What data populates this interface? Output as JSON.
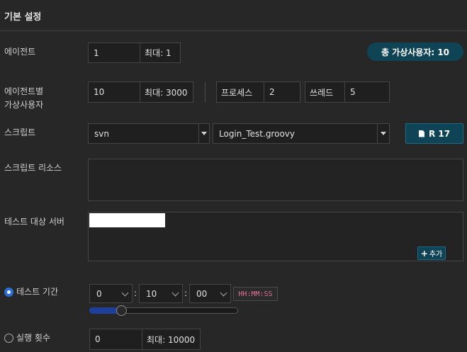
{
  "section_title": "기본 설정",
  "agent": {
    "label": "에이전트",
    "value": "1",
    "max_label": "최대: 1",
    "total_vusers": "총 가상사용자: 10"
  },
  "vusers_per_agent": {
    "label_line1": "에이전트별",
    "label_line2": "가상사용자",
    "value": "10",
    "max_label": "최대: 3000",
    "process_label": "프로세스",
    "process_value": "2",
    "thread_label": "쓰레드",
    "thread_value": "5"
  },
  "script": {
    "label": "스크립트",
    "repo": "svn",
    "file": "Login_Test.groovy",
    "revision_button": "R 17"
  },
  "script_resources": {
    "label": "스크립트 리소스"
  },
  "target_servers": {
    "label": "테스트 대상 서버",
    "add_button": "추가"
  },
  "duration": {
    "label": "테스트 기간",
    "selected": true,
    "hours": "0",
    "minutes": "10",
    "seconds": "00",
    "format_hint": "HH:MM:SS",
    "slider_fraction": 0.22
  },
  "run_count": {
    "label": "실행 횟수",
    "selected": false,
    "value": "0",
    "max_label": "최대: 10000"
  },
  "colors": {
    "accent": "#0f4457",
    "radio_on": "#2b6fd6",
    "format_hint_text": "#e0709a"
  }
}
